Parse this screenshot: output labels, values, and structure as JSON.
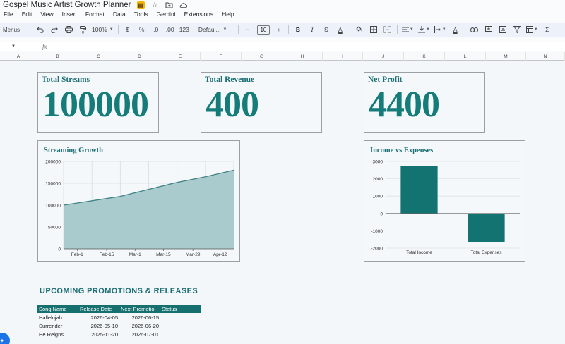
{
  "app": {
    "doc_title": "Gospel Music Artist Growth Planner",
    "title_icons": [
      "slides-badge-icon",
      "star-icon",
      "move-folder-icon",
      "cloud-status-icon"
    ]
  },
  "menu": [
    "File",
    "Edit",
    "View",
    "Insert",
    "Format",
    "Data",
    "Tools",
    "Gemini",
    "Extensions",
    "Help"
  ],
  "toolbar": {
    "menus_label": "Menus",
    "zoom": "100%",
    "currency": "$",
    "percent": "%",
    "decrease_decimal": ".0",
    "increase_decimal": ".00",
    "number_format": "123",
    "font_family": "Defaul...",
    "font_size_minus": "−",
    "font_size": "10",
    "font_size_plus": "+",
    "bold": "B",
    "italic": "I",
    "strike": "S",
    "text_color": "A",
    "text_color_2": "A",
    "sum": "Σ"
  },
  "formula_bar": {
    "fx": "fx"
  },
  "columns": [
    "A",
    "B",
    "C",
    "D",
    "E",
    "F",
    "G",
    "H",
    "I",
    "J",
    "K",
    "L",
    "M",
    "N"
  ],
  "kpis": {
    "streams": {
      "label": "Total Streams",
      "value": "100000"
    },
    "revenue": {
      "label": "Total Revenue",
      "value": "400"
    },
    "profit": {
      "label": "Net Profit",
      "value": "4400"
    }
  },
  "chart_data": [
    {
      "type": "area",
      "title": "Streaming Growth",
      "categories": [
        "Feb-1",
        "Feb-15",
        "Mar-1",
        "Mar-15",
        "Mar-29",
        "Apr-12"
      ],
      "x_index_of_categories": [
        0.12,
        0.38,
        0.63,
        0.88,
        1.14,
        1.38
      ],
      "series": [
        {
          "values": [
            100000,
            110000,
            120000,
            136000,
            152000,
            165000,
            180000
          ]
        }
      ],
      "ylim": [
        0,
        200000
      ],
      "yticks": [
        "0",
        "50000",
        "100000",
        "150000",
        "200000"
      ],
      "ytick_values": [
        0,
        50000,
        100000,
        150000,
        200000
      ],
      "grid": true,
      "colors": {
        "fill": "#a9cbcd",
        "line": "#3f8285"
      }
    },
    {
      "type": "bar",
      "title": "Income vs Expenses",
      "categories": [
        "Total Income",
        "Total Expenses"
      ],
      "values": [
        2750,
        -1650
      ],
      "ylim": [
        -2000,
        3000
      ],
      "yticks": [
        "-2000",
        "-1000",
        "0",
        "1000",
        "2000",
        "3000"
      ],
      "ytick_values": [
        -2000,
        -1000,
        0,
        1000,
        2000,
        3000
      ],
      "grid": true,
      "colors": {
        "bar": "#137370"
      }
    }
  ],
  "promotions": {
    "heading": "UPCOMING PROMOTIONS & RELEASES",
    "columns": [
      "Song Name",
      "Release Date",
      "Next Promotio",
      "Status"
    ],
    "rows": [
      {
        "song": "Hallelujah",
        "release": "2026-04-05",
        "next": "2026-06-15",
        "status": ""
      },
      {
        "song": "Surrender",
        "release": "2026-05-10",
        "next": "2026-06-20",
        "status": ""
      },
      {
        "song": "He Reigns",
        "release": "2025-11-20",
        "next": "2026-07-01",
        "status": ""
      }
    ]
  },
  "colors": {
    "accent_teal": "#167c7a",
    "header_teal": "#16706f",
    "toolbar_bg": "#edf2fa"
  }
}
